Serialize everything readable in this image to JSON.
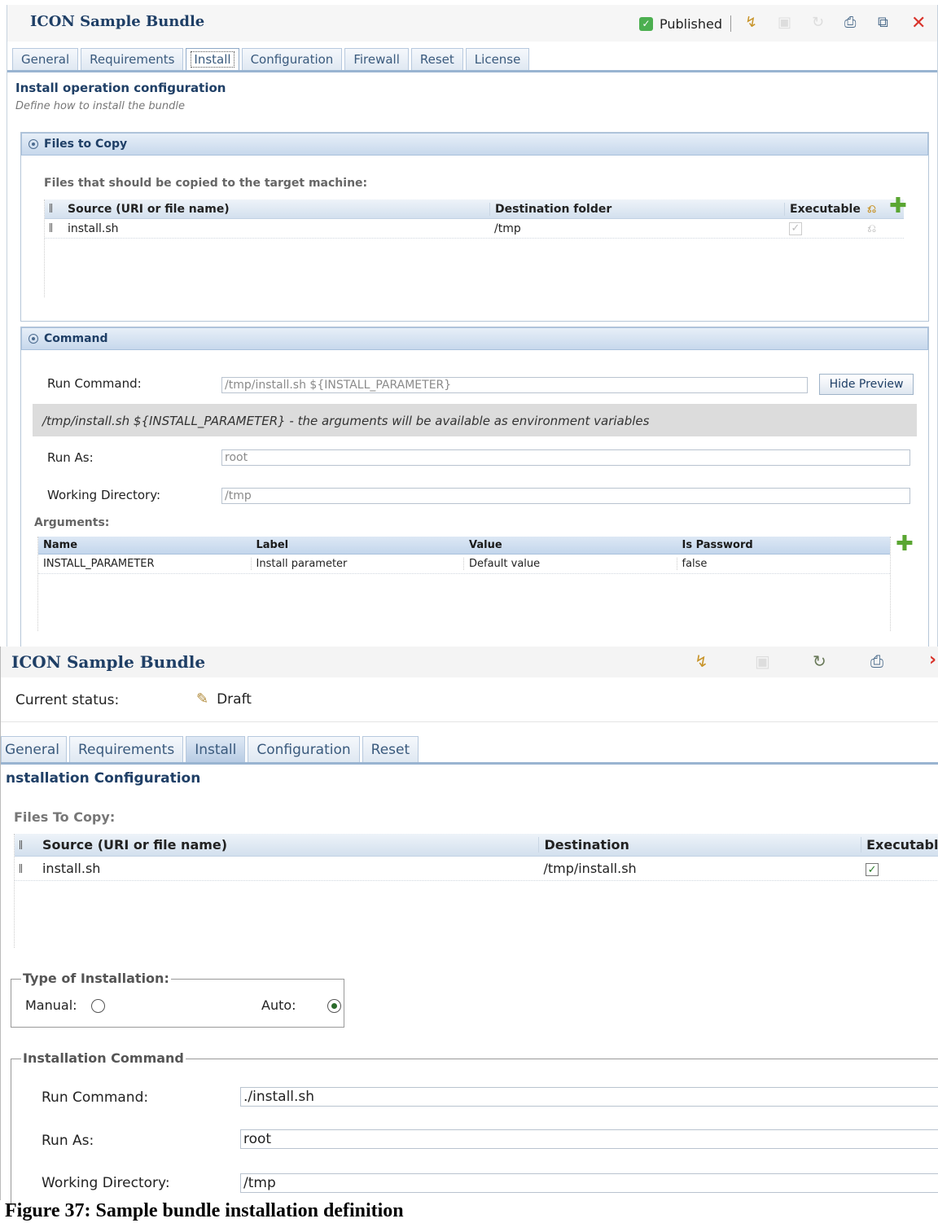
{
  "top": {
    "title": "ICON Sample Bundle",
    "status": "Published",
    "tabs": [
      "General",
      "Requirements",
      "Install",
      "Configuration",
      "Firewall",
      "Reset",
      "License"
    ],
    "active_tab": "Install",
    "section_title": "Install operation configuration",
    "section_subtitle": "Define how to install the bundle",
    "files_panel": {
      "title": "Files to Copy",
      "intro": "Files that should be copied to the target machine:",
      "columns": [
        "Source (URI or file name)",
        "Destination folder",
        "Executable"
      ],
      "rows": [
        {
          "source": "install.sh",
          "destination": "/tmp"
        }
      ]
    },
    "command_panel": {
      "title": "Command",
      "run_command_label": "Run Command:",
      "run_command_value": "/tmp/install.sh ${INSTALL_PARAMETER}",
      "hide_preview_label": "Hide Preview",
      "preview_text": "/tmp/install.sh ${INSTALL_PARAMETER} - the arguments will be available as environment variables",
      "run_as_label": "Run As:",
      "run_as_value": "root",
      "working_dir_label": "Working Directory:",
      "working_dir_value": "/tmp",
      "arguments_label": "Arguments:",
      "arg_columns": [
        "Name",
        "Label",
        "Value",
        "Is Password"
      ],
      "arg_rows": [
        {
          "name": "INSTALL_PARAMETER",
          "label": "Install parameter",
          "value": "Default value",
          "is_password": "false"
        }
      ]
    }
  },
  "bottom": {
    "title": "ICON Sample Bundle",
    "current_status_label": "Current status:",
    "current_status_value": "Draft",
    "tabs": [
      "General",
      "Requirements",
      "Install",
      "Configuration",
      "Reset"
    ],
    "active_tab": "Install",
    "section_title": "nstallation Configuration",
    "files_label": "Files To Copy:",
    "columns": [
      "Source (URI or file name)",
      "Destination",
      "Executable"
    ],
    "rows": [
      {
        "source": "install.sh",
        "destination": "/tmp/install.sh",
        "executable": true
      }
    ],
    "type_legend": "Type of Installation:",
    "manual_label": "Manual:",
    "auto_label": "Auto:",
    "selected_type": "Auto",
    "command_legend": "Installation Command",
    "run_command_label": "Run Command:",
    "run_command_value": "./install.sh",
    "run_as_label": "Run As:",
    "run_as_value": "root",
    "working_dir_label": "Working Directory:",
    "working_dir_value": "/tmp"
  },
  "caption": "Figure 37: Sample bundle installation definition"
}
